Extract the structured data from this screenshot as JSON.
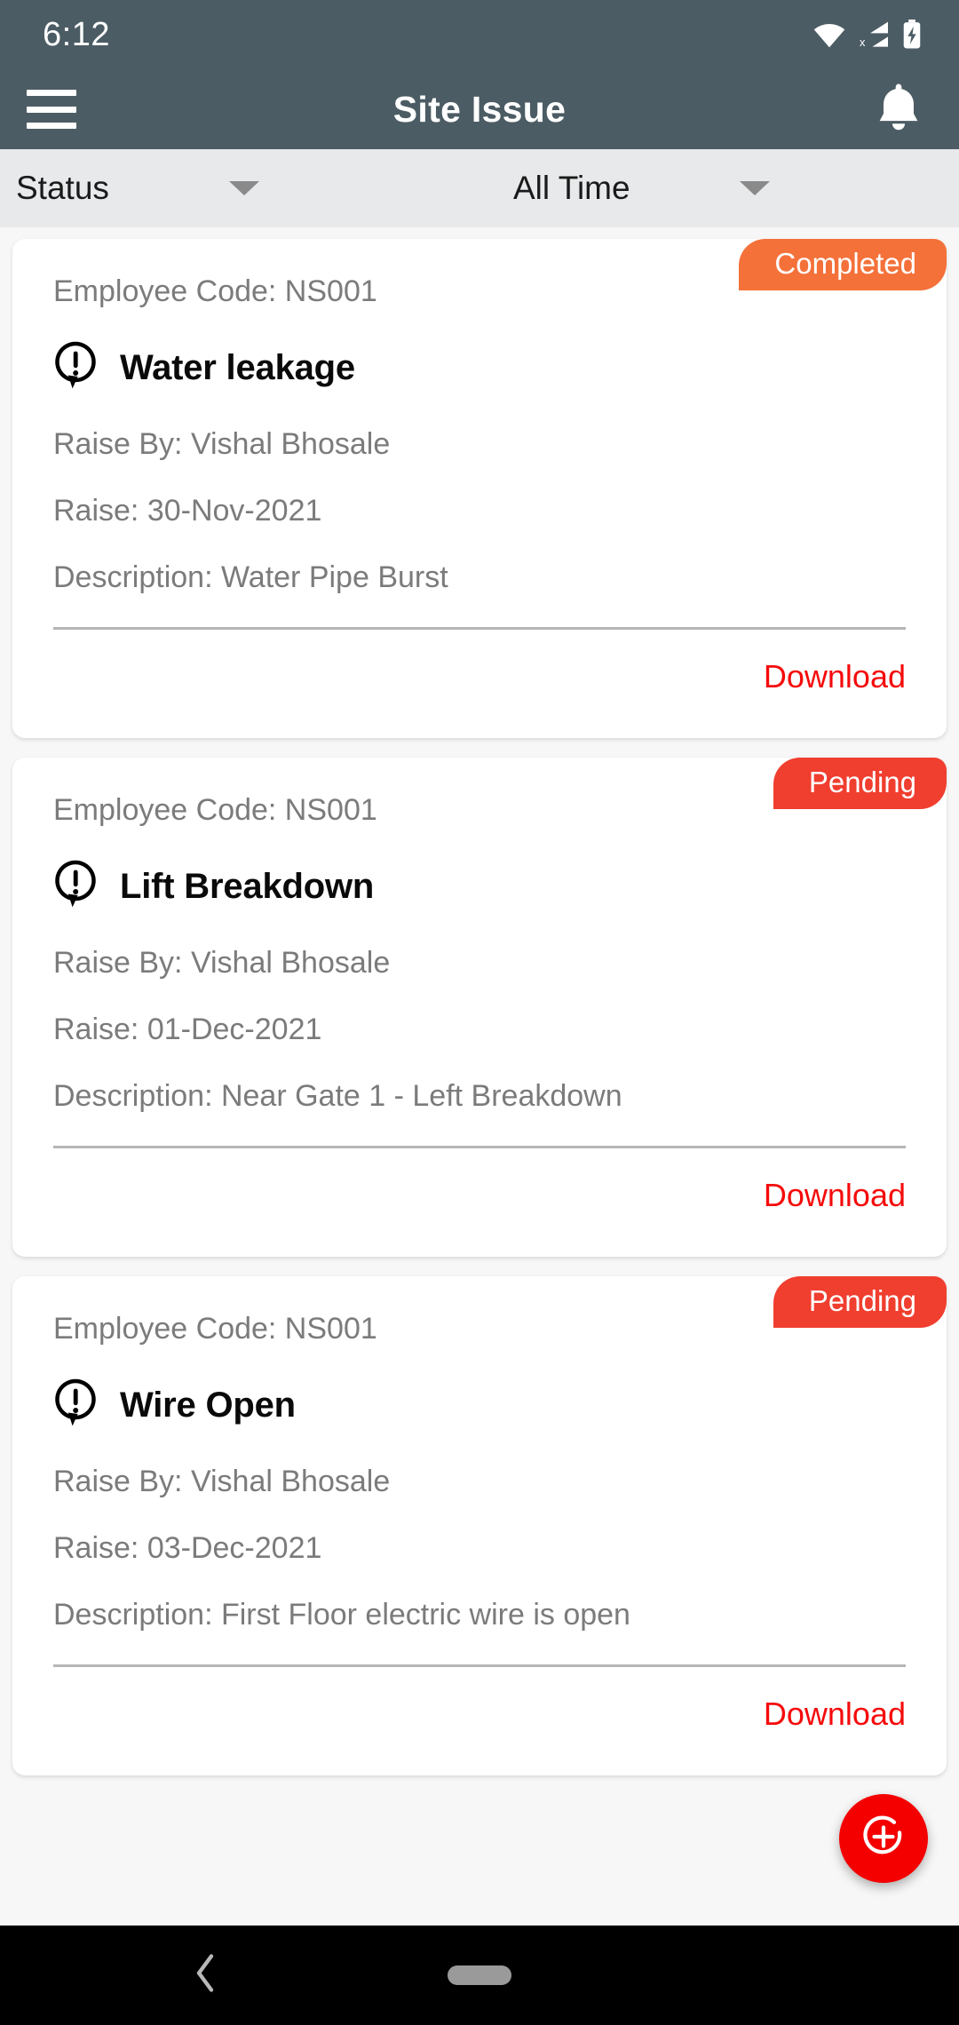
{
  "status_bar": {
    "clock": "6:12",
    "icons": [
      "wifi-icon",
      "cellular-no-sim-icon",
      "battery-charging-icon"
    ]
  },
  "app_bar": {
    "menu_icon": "hamburger-menu-icon",
    "title": "Site Issue",
    "notification_icon": "bell-icon"
  },
  "filter_bar": {
    "status_filter": {
      "label": "Status",
      "caret": "chevron-down-icon"
    },
    "time_filter": {
      "label": "All Time",
      "caret": "chevron-down-icon"
    }
  },
  "colors": {
    "header_bg": "#4C5C64",
    "filter_bg": "#E8E9EB",
    "page_bg": "#F7F7F7",
    "badge_completed": "#F4713A",
    "badge_pending": "#F03E2F",
    "download_link": "#F50B0B",
    "fab": "#F40000",
    "muted_text": "#7B7B7B"
  },
  "cards": [
    {
      "badge": "Completed",
      "badge_color": "#F4713A",
      "employee_code": "Employee Code: NS001",
      "issue_icon": "alert-exclamation-icon",
      "issue_title": "Water leakage",
      "raised_by": "Raise By: Vishal Bhosale",
      "raise_date": "Raise: 30-Nov-2021",
      "description": "Description: Water Pipe Burst",
      "action": "Download"
    },
    {
      "badge": "Pending",
      "badge_color": "#F03E2F",
      "employee_code": "Employee Code: NS001",
      "issue_icon": "alert-exclamation-icon",
      "issue_title": "Lift Breakdown",
      "raised_by": "Raise By: Vishal Bhosale",
      "raise_date": "Raise: 01-Dec-2021",
      "description": "Description: Near Gate 1 - Left Breakdown",
      "action": "Download"
    },
    {
      "badge": "Pending",
      "badge_color": "#F03E2F",
      "employee_code": "Employee Code: NS001",
      "issue_icon": "alert-exclamation-icon",
      "issue_title": "Wire Open",
      "raised_by": "Raise By: Vishal Bhosale",
      "raise_date": "Raise: 03-Dec-2021",
      "description": "Description: First Floor electric wire is open",
      "action": "Download"
    }
  ],
  "fab": {
    "icon": "add-circle-plus-icon"
  },
  "nav_bar": {
    "back_icon": "back-chevron-icon",
    "home_icon": "home-pill-icon"
  }
}
